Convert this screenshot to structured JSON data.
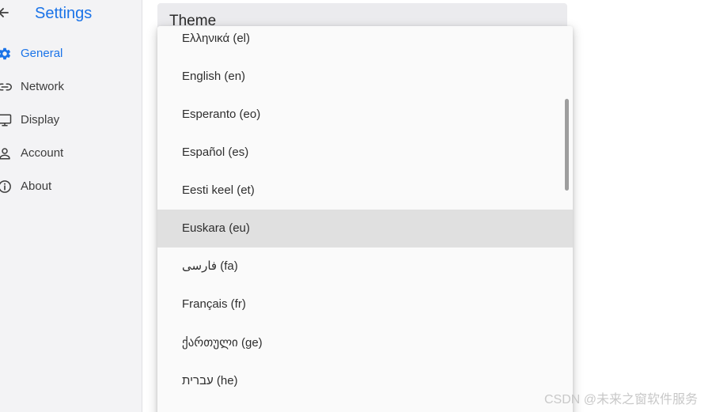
{
  "sidebar": {
    "title": "Settings",
    "items": [
      {
        "label": "General",
        "icon": "gear-icon",
        "active": true
      },
      {
        "label": "Network",
        "icon": "link-icon",
        "active": false
      },
      {
        "label": "Display",
        "icon": "monitor-icon",
        "active": false
      },
      {
        "label": "Account",
        "icon": "person-icon",
        "active": false
      },
      {
        "label": "About",
        "icon": "info-icon",
        "active": false
      }
    ]
  },
  "main": {
    "theme_label": "Theme"
  },
  "language_menu": {
    "items": [
      {
        "label": "Ελληνικά (el)"
      },
      {
        "label": "English (en)"
      },
      {
        "label": "Esperanto (eo)"
      },
      {
        "label": "Español (es)"
      },
      {
        "label": "Eesti keel (et)"
      },
      {
        "label": "Euskara (eu)",
        "highlighted": true
      },
      {
        "label": "فارسی (fa)"
      },
      {
        "label": "Français (fr)"
      },
      {
        "label": "ქართული (ge)"
      },
      {
        "label": "עברית (he)"
      }
    ]
  },
  "watermark": "CSDN @未来之窗软件服务",
  "colors": {
    "accent": "#1a73e8",
    "sidebar_bg": "#f3f3f5",
    "menu_bg": "#fafafa",
    "highlight_bg": "#e0e0e0"
  }
}
